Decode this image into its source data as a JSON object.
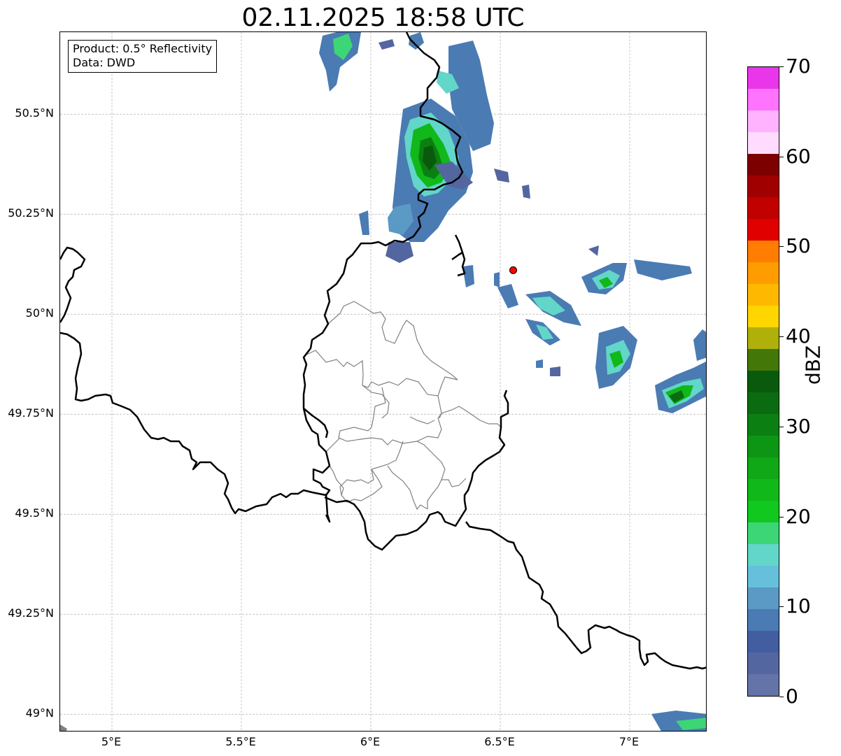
{
  "title": "02.11.2025 18:58 UTC",
  "info": {
    "product": "Product: 0.5° Reflectivity",
    "source": "Data: DWD"
  },
  "map": {
    "lat_range": [
      48.955,
      50.705
    ],
    "lon_range": [
      4.8,
      7.3
    ],
    "lat_ticks": [
      {
        "value": 50.5,
        "label": "50.5°N"
      },
      {
        "value": 50.25,
        "label": "50.25°N"
      },
      {
        "value": 50.0,
        "label": "50°N"
      },
      {
        "value": 49.75,
        "label": "49.75°N"
      },
      {
        "value": 49.5,
        "label": "49.5°N"
      },
      {
        "value": 49.25,
        "label": "49.25°N"
      },
      {
        "value": 49.0,
        "label": "49°N"
      }
    ],
    "lon_ticks": [
      {
        "value": 5.0,
        "label": "5°E"
      },
      {
        "value": 5.5,
        "label": "5.5°E"
      },
      {
        "value": 6.0,
        "label": "6°E"
      },
      {
        "value": 6.5,
        "label": "6.5°E"
      },
      {
        "value": 7.0,
        "label": "7°E"
      }
    ],
    "gridlines": true,
    "radar_site": {
      "lat": 50.11,
      "lon": 6.55
    },
    "colors": {
      "border": "#000000",
      "district": "#808080",
      "grid": "#b0b0b0",
      "site": "#ff0000"
    }
  },
  "colorbar": {
    "label": "dBZ",
    "min": 0,
    "max": 70,
    "step": 2.5,
    "ticks": [
      {
        "value": 0,
        "label": "0"
      },
      {
        "value": 10,
        "label": "10"
      },
      {
        "value": 20,
        "label": "20"
      },
      {
        "value": 30,
        "label": "30"
      },
      {
        "value": 40,
        "label": "40"
      },
      {
        "value": 50,
        "label": "50"
      },
      {
        "value": 60,
        "label": "60"
      },
      {
        "value": 70,
        "label": "70"
      }
    ],
    "colors": [
      "#6473a8",
      "#5466a0",
      "#435ea0",
      "#4a7bb3",
      "#5a9ac4",
      "#66c0db",
      "#62d6c8",
      "#3dd676",
      "#10c81e",
      "#10b81a",
      "#10a816",
      "#0c9614",
      "#0b7f12",
      "#0b6b10",
      "#0a5a0d",
      "#437708",
      "#afb00a",
      "#ffd600",
      "#ffb800",
      "#ff9c00",
      "#ff7d00",
      "#e00000",
      "#c10000",
      "#a00000",
      "#7d0000",
      "#ffdcff",
      "#ffb3ff",
      "#ff73ff",
      "#ea36ea"
    ]
  }
}
